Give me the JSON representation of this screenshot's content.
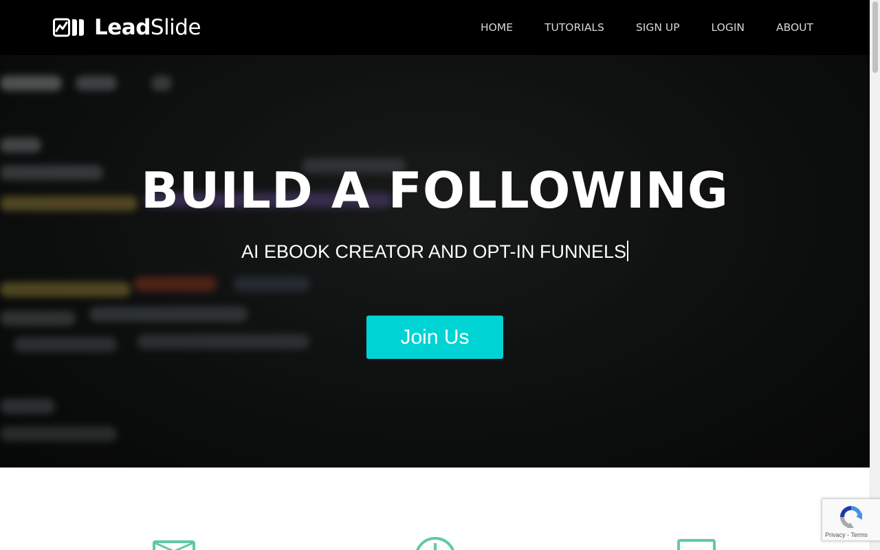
{
  "brand": {
    "name_bold": "Lead",
    "name_regular": "Slide",
    "logo_icon": "leadslide-logo-icon"
  },
  "nav": {
    "items": [
      {
        "label": "HOME"
      },
      {
        "label": "TUTORIALS"
      },
      {
        "label": "SIGN UP"
      },
      {
        "label": "LOGIN"
      },
      {
        "label": "ABOUT"
      }
    ]
  },
  "hero": {
    "title": "BUILD A FOLLOWING",
    "subtitle": "AI EBOOK CREATOR AND OPT-IN FUNNELS",
    "cta_label": "Join Us",
    "cta_color": "#00d3d3",
    "background": "blurred-code-photo"
  },
  "features": {
    "icons": [
      {
        "icon": "envelope-icon"
      },
      {
        "icon": "clock-icon"
      },
      {
        "icon": "monitor-icon"
      }
    ],
    "accent_color": "#5fc9a8"
  },
  "recaptcha": {
    "privacy_label": "Privacy",
    "separator": "-",
    "terms_label": "Terms"
  }
}
